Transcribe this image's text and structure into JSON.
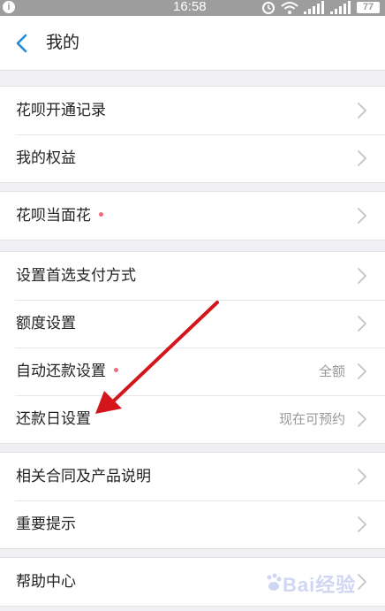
{
  "status_bar": {
    "info_glyph": "i",
    "time": "16:58",
    "battery": "77",
    "icons": [
      "alarm-icon",
      "wifi-icon",
      "signal-icon",
      "signal-icon"
    ]
  },
  "nav": {
    "back_icon": "chevron-left-icon",
    "title": "我的"
  },
  "groups": [
    {
      "rows": [
        {
          "label": "花呗开通记录",
          "dot": false,
          "value": ""
        },
        {
          "label": "我的权益",
          "dot": false,
          "value": ""
        }
      ]
    },
    {
      "rows": [
        {
          "label": "花呗当面花",
          "dot": true,
          "value": ""
        }
      ]
    },
    {
      "rows": [
        {
          "label": "设置首选支付方式",
          "dot": false,
          "value": ""
        },
        {
          "label": "额度设置",
          "dot": false,
          "value": ""
        },
        {
          "label": "自动还款设置",
          "dot": true,
          "value": "全额"
        },
        {
          "label": "还款日设置",
          "dot": false,
          "value": "现在可预约"
        }
      ]
    },
    {
      "rows": [
        {
          "label": "相关合同及产品说明",
          "dot": false,
          "value": ""
        },
        {
          "label": "重要提示",
          "dot": false,
          "value": ""
        }
      ]
    },
    {
      "rows": [
        {
          "label": "帮助中心",
          "dot": false,
          "value": ""
        }
      ]
    }
  ],
  "watermark": {
    "text": "Bai经验"
  },
  "colors": {
    "accent": "#1f8bd9",
    "dot": "#ec6d7a",
    "arrow": "#d4161c",
    "background": "#efeff4"
  }
}
